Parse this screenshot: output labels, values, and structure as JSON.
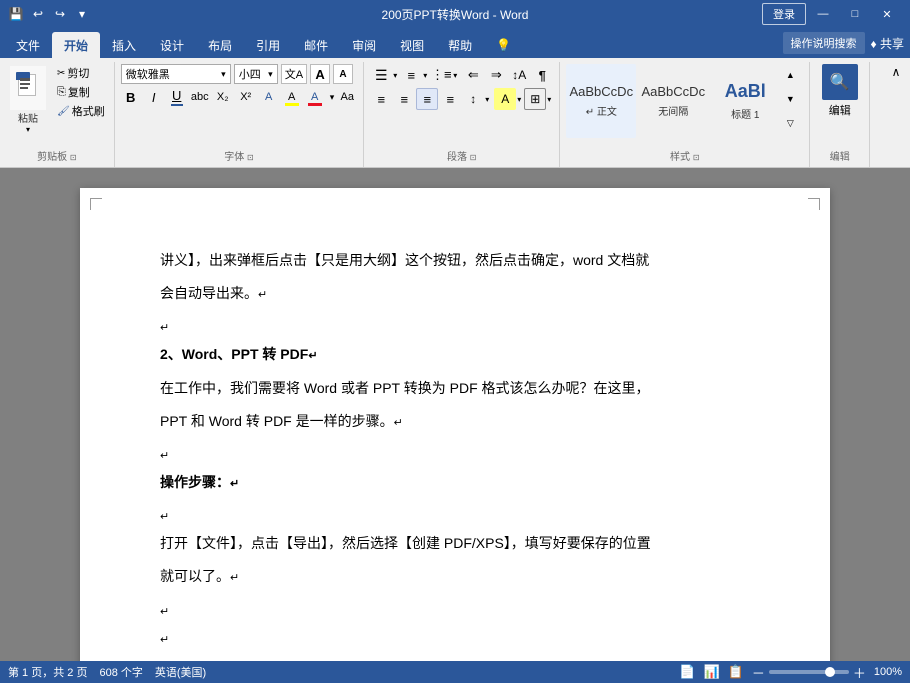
{
  "titlebar": {
    "title": "200页PPT转换Word - Word",
    "save_icon": "💾",
    "undo_icon": "↩",
    "redo_icon": "↪",
    "customize_icon": "▾",
    "signin_label": "登录",
    "minimize_label": "—",
    "maximize_label": "□",
    "close_label": "✕"
  },
  "ribbon_tabs": {
    "tabs": [
      "文件",
      "开始",
      "插入",
      "设计",
      "布局",
      "引用",
      "邮件",
      "审阅",
      "视图",
      "帮助"
    ],
    "active_tab": "开始",
    "search_placeholder": "操作说明搜索",
    "share_label": "♦ 共享"
  },
  "ribbon": {
    "clipboard": {
      "label": "剪贴板",
      "paste_label": "粘贴",
      "cut_label": "剪切",
      "copy_label": "复制",
      "format_paint_label": "格式刷",
      "expand_icon": "⊡"
    },
    "font": {
      "label": "字体",
      "font_name": "微软雅黑",
      "font_size": "小四",
      "wf_icon": "文A",
      "bold": "B",
      "italic": "I",
      "underline": "U",
      "strikethrough": "abc",
      "subscript": "X₂",
      "superscript": "X²",
      "font_color_label": "A",
      "highlight_label": "A",
      "aa_label": "Aa",
      "font_grow": "A",
      "font_shrink": "A",
      "expand_icon": "⊡"
    },
    "paragraph": {
      "label": "段落",
      "expand_icon": "⊡"
    },
    "styles": {
      "label": "样式",
      "items": [
        {
          "name": "正文",
          "sample": "AaBbCcDc",
          "active": true
        },
        {
          "name": "无间隔",
          "sample": "AaBbCcDc"
        },
        {
          "name": "标题 1",
          "sample": "AaBl"
        }
      ],
      "expand_icon": "⊡"
    },
    "editing": {
      "label": "编辑",
      "search_icon": "🔍"
    }
  },
  "document": {
    "page_info": "第 1 页，共 2 页",
    "word_count": "608 个字",
    "language": "英语(美国)",
    "paragraphs": [
      {
        "type": "text",
        "content": "讲义】，出来弹框后点击【只是用大纲】这个按钮，然后点击确定，word 文档就"
      },
      {
        "type": "text",
        "content": "会自动导出来。↵"
      },
      {
        "type": "empty"
      },
      {
        "type": "heading",
        "content": "2、Word、PPT 转 PDF↵"
      },
      {
        "type": "text",
        "content": "在工作中，我们需要将 Word 或者 PPT 转换为 PDF 格式该怎么办呢？在这里，"
      },
      {
        "type": "text",
        "content": "PPT 和 Word 转 PDF 是一样的步骤。↵"
      },
      {
        "type": "empty"
      },
      {
        "type": "bold",
        "content": "操作步骤：↵"
      },
      {
        "type": "empty"
      },
      {
        "type": "text",
        "content": "打开【文件】，点击【导出】，然后选择【创建 PDF/XPS】，填写好要保存的位置"
      },
      {
        "type": "text",
        "content": "就可以了。↵"
      },
      {
        "type": "empty"
      },
      {
        "type": "empty",
        "content": "↵"
      }
    ]
  },
  "statusbar": {
    "page_info": "第 1 页，共 2 页",
    "word_count": "608 个字",
    "language": "英语(美国)",
    "zoom_percent": "100%"
  }
}
